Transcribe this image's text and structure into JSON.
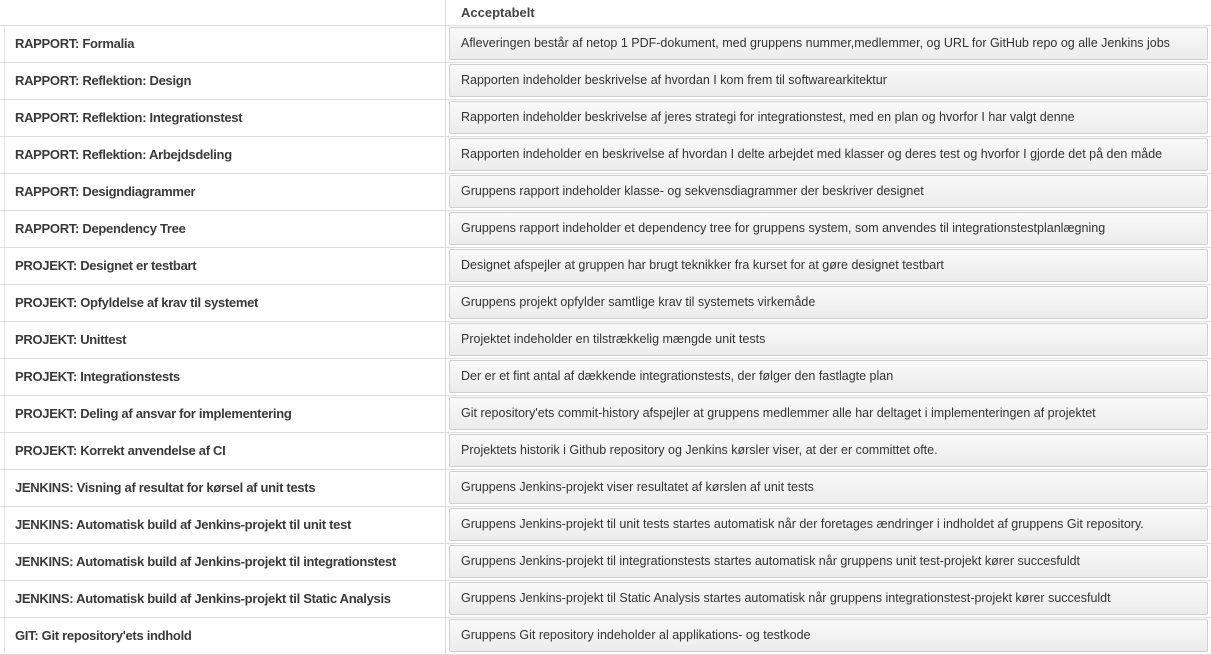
{
  "header": {
    "level_label": "Acceptabelt"
  },
  "rows": [
    {
      "criterion": "RAPPORT: Formalia",
      "description": "Afleveringen består af netop 1 PDF-dokument, med gruppens nummer,medlemmer, og URL for GitHub repo og alle Jenkins jobs"
    },
    {
      "criterion": "RAPPORT: Reflektion: Design",
      "description": "Rapporten indeholder beskrivelse af hvordan I kom frem til softwarearkitektur"
    },
    {
      "criterion": "RAPPORT: Reflektion: Integrationstest",
      "description": "Rapporten indeholder beskrivelse af jeres strategi for integrationstest, med en plan og hvorfor I har valgt denne"
    },
    {
      "criterion": "RAPPORT: Reflektion: Arbejdsdeling",
      "description": "Rapporten indeholder en beskrivelse af hvordan I delte arbejdet med klasser og deres test og hvorfor I gjorde det på den måde"
    },
    {
      "criterion": "RAPPORT: Designdiagrammer",
      "description": "Gruppens rapport indeholder klasse- og sekvensdiagrammer der beskriver designet"
    },
    {
      "criterion": "RAPPORT: Dependency Tree",
      "description": "Gruppens rapport indeholder et dependency tree for gruppens system, som anvendes til integrationstestplanlægning"
    },
    {
      "criterion": "PROJEKT: Designet er testbart",
      "description": "Designet afspejler at gruppen har brugt teknikker fra kurset for at gøre designet testbart"
    },
    {
      "criterion": "PROJEKT: Opfyldelse af krav til systemet",
      "description": "Gruppens projekt opfylder samtlige krav til systemets virkemåde"
    },
    {
      "criterion": "PROJEKT: Unittest",
      "description": "Projektet indeholder en tilstrækkelig mængde unit tests"
    },
    {
      "criterion": "PROJEKT: Integrationstests",
      "description": "Der er et fint antal af dækkende integrationstests, der følger den fastlagte plan"
    },
    {
      "criterion": "PROJEKT: Deling af ansvar for implementering",
      "description": "Git repository'ets commit-history afspejler at gruppens medlemmer alle har deltaget i implementeringen af projektet"
    },
    {
      "criterion": "PROJEKT: Korrekt anvendelse af CI",
      "description": "Projektets historik i Github repository og Jenkins kørsler viser, at der er committet ofte."
    },
    {
      "criterion": "JENKINS: Visning af resultat for kørsel af unit tests",
      "description": "Gruppens Jenkins-projekt viser resultatet af kørslen af unit tests"
    },
    {
      "criterion": "JENKINS: Automatisk build af Jenkins-projekt til unit test",
      "description": "Gruppens Jenkins-projekt til unit tests startes automatisk når der foretages ændringer i indholdet af gruppens Git repository."
    },
    {
      "criterion": "JENKINS: Automatisk build af Jenkins-projekt til integrationstest",
      "description": "Gruppens Jenkins-projekt til integrationstests startes automatisk når gruppens unit test-projekt kører succesfuldt"
    },
    {
      "criterion": "JENKINS: Automatisk build af Jenkins-projekt til Static Analysis",
      "description": "Gruppens Jenkins-projekt til Static Analysis startes automatisk når gruppens integrationstest-projekt kører succesfuldt"
    },
    {
      "criterion": "GIT: Git repository'ets indhold",
      "description": "Gruppens Git repository indeholder al applikations- og testkode"
    }
  ]
}
